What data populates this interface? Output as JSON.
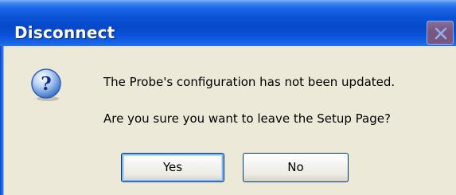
{
  "window": {
    "title": "Disconnect",
    "close_icon": "close-icon"
  },
  "dialog": {
    "icon": "question-icon",
    "message_line1": "The Probe's configuration has not been updated.",
    "message_line2": "Are you sure you want to leave the Setup Page?"
  },
  "buttons": {
    "yes_label": "Yes",
    "no_label": "No"
  },
  "colors": {
    "titlebar_blue": "#0a53d6",
    "dialog_face": "#ece9d8",
    "button_border": "#003c74",
    "focus_ring": "#7fb1f0"
  }
}
